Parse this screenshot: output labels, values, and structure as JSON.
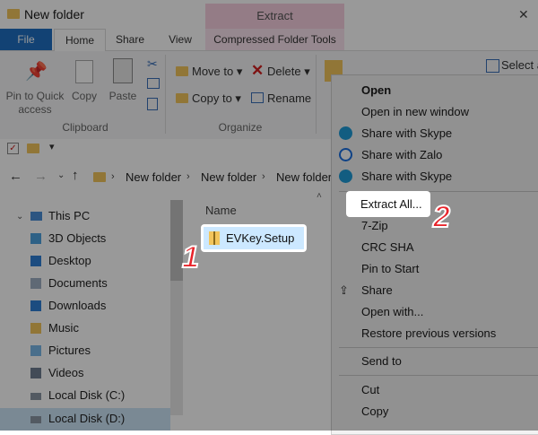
{
  "window": {
    "title": "New folder"
  },
  "ribbon": {
    "contextual_tab": "Extract",
    "tabs": [
      "File",
      "Home",
      "Share",
      "View",
      "Compressed Folder Tools"
    ],
    "clipboard": {
      "pin_label_1": "Pin to Quick",
      "pin_label_2": "access",
      "copy": "Copy",
      "paste": "Paste",
      "group": "Clipboard"
    },
    "organize": {
      "move_to": "Move to",
      "copy_to": "Copy to",
      "delete": "Delete",
      "rename": "Rename",
      "group": "Organize"
    },
    "select_all": "Select al"
  },
  "address": {
    "crumbs": [
      "New folder",
      "New folder",
      "New folder"
    ]
  },
  "nav_pane": {
    "items": [
      "This PC",
      "3D Objects",
      "Desktop",
      "Documents",
      "Downloads",
      "Music",
      "Pictures",
      "Videos",
      "Local Disk (C:)",
      "Local Disk (D:)"
    ]
  },
  "file_list": {
    "column_name": "Name",
    "selected_file": "EVKey.Setup"
  },
  "context_menu": {
    "items": [
      "Open",
      "Open in new window",
      "Share with Skype",
      "Share with Zalo",
      "Share with Skype",
      "Extract All...",
      "7-Zip",
      "CRC SHA",
      "Pin to Start",
      "Share",
      "Open with...",
      "Restore previous versions",
      "Send to",
      "Cut",
      "Copy"
    ]
  },
  "annotations": {
    "step1": "1",
    "step2": "2"
  },
  "colors": {
    "file_tab": "#1f6fc2",
    "extract_tab": "#f7cfe0",
    "badge_red": "#e8232a"
  }
}
